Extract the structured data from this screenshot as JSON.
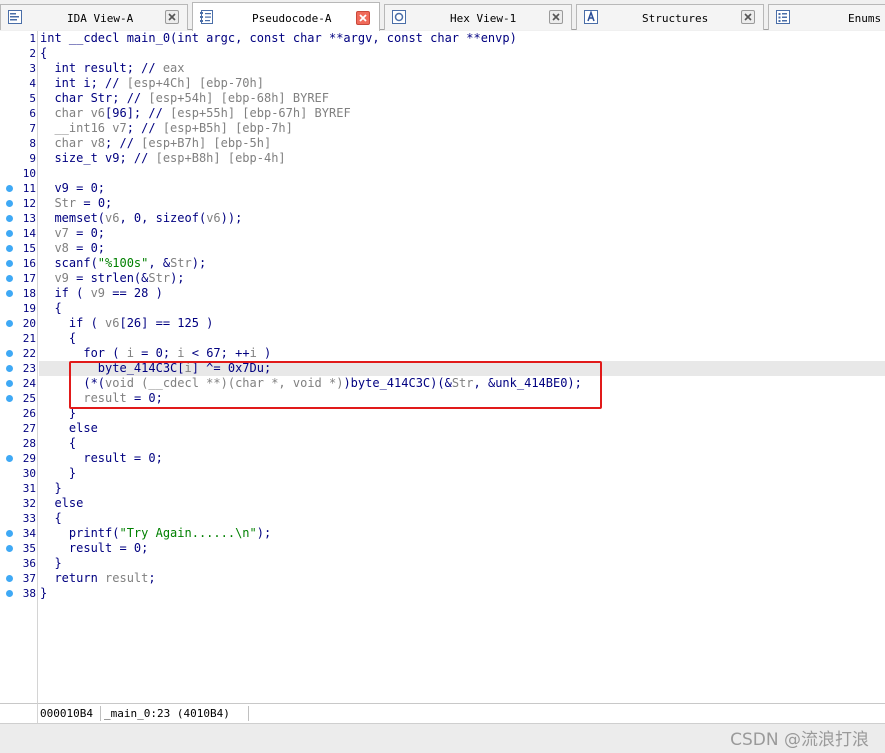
{
  "tabs": [
    {
      "label": "IDA View-A",
      "icon": "ida-view-icon"
    },
    {
      "label": "Pseudocode-A",
      "icon": "pseudocode-icon",
      "active": true
    },
    {
      "label": "Hex View-1",
      "icon": "hex-view-icon"
    },
    {
      "label": "Structures",
      "icon": "structures-icon"
    },
    {
      "label": "Enums",
      "icon": "enums-icon"
    }
  ],
  "code": {
    "line_numbers": [
      "1",
      "2",
      "3",
      "4",
      "5",
      "6",
      "7",
      "8",
      "9",
      "10",
      "11",
      "12",
      "13",
      "14",
      "15",
      "16",
      "17",
      "18",
      "19",
      "20",
      "21",
      "22",
      "23",
      "24",
      "25",
      "26",
      "27",
      "28",
      "29",
      "30",
      "31",
      "32",
      "33",
      "34",
      "35",
      "36",
      "37",
      "38"
    ],
    "breakpoint_lines": [
      11,
      12,
      13,
      14,
      15,
      16,
      17,
      18,
      20,
      22,
      23,
      24,
      25,
      29,
      34,
      35,
      37,
      38
    ],
    "highlighted_line": 23,
    "lines": [
      [
        [
          "int __cdecl main_0(int argc, const char **argv, const char **envp)",
          "n"
        ]
      ],
      [
        [
          "{",
          "n"
        ]
      ],
      [
        [
          "  int result; // ",
          "n"
        ],
        [
          "eax",
          "g"
        ]
      ],
      [
        [
          "  int i; // ",
          "n"
        ],
        [
          "[esp+4Ch] [ebp-70h]",
          "g"
        ]
      ],
      [
        [
          "  char Str; // ",
          "n"
        ],
        [
          "[esp+54h] [ebp-68h] BYREF",
          "g"
        ]
      ],
      [
        [
          "  ",
          "n"
        ],
        [
          "char v6",
          "g"
        ],
        [
          "[96]; // ",
          "n"
        ],
        [
          "[esp+55h] [ebp-67h] BYREF",
          "g"
        ]
      ],
      [
        [
          "  ",
          "n"
        ],
        [
          "__int16 v7",
          "g"
        ],
        [
          "; // ",
          "n"
        ],
        [
          "[esp+B5h] [ebp-7h]",
          "g"
        ]
      ],
      [
        [
          "  ",
          "n"
        ],
        [
          "char v8",
          "g"
        ],
        [
          "; // ",
          "n"
        ],
        [
          "[esp+B7h] [ebp-5h]",
          "g"
        ]
      ],
      [
        [
          "  size_t v9; // ",
          "n"
        ],
        [
          "[esp+B8h] [ebp-4h]",
          "g"
        ]
      ],
      [
        [
          "",
          "n"
        ]
      ],
      [
        [
          "  v9 = 0;",
          "n"
        ]
      ],
      [
        [
          "  ",
          "n"
        ],
        [
          "Str",
          "g"
        ],
        [
          " = 0;",
          "n"
        ]
      ],
      [
        [
          "  memset(",
          "n"
        ],
        [
          "v6",
          "g"
        ],
        [
          ", 0, sizeof(",
          "n"
        ],
        [
          "v6",
          "g"
        ],
        [
          "));",
          "n"
        ]
      ],
      [
        [
          "  ",
          "n"
        ],
        [
          "v7",
          "g"
        ],
        [
          " = 0;",
          "n"
        ]
      ],
      [
        [
          "  ",
          "n"
        ],
        [
          "v8",
          "g"
        ],
        [
          " = 0;",
          "n"
        ]
      ],
      [
        [
          "  scanf(",
          "n"
        ],
        [
          "\"%100s\"",
          "s"
        ],
        [
          ", &",
          "n"
        ],
        [
          "Str",
          "g"
        ],
        [
          ");",
          "n"
        ]
      ],
      [
        [
          "  ",
          "n"
        ],
        [
          "v9",
          "g"
        ],
        [
          " = strlen(&",
          "n"
        ],
        [
          "Str",
          "g"
        ],
        [
          ");",
          "n"
        ]
      ],
      [
        [
          "  if ( ",
          "n"
        ],
        [
          "v9",
          "g"
        ],
        [
          " == 28 )",
          "n"
        ]
      ],
      [
        [
          "  {",
          "n"
        ]
      ],
      [
        [
          "    if ( ",
          "n"
        ],
        [
          "v6",
          "g"
        ],
        [
          "[26] == 125 )",
          "n"
        ]
      ],
      [
        [
          "    {",
          "n"
        ]
      ],
      [
        [
          "      for ( ",
          "n"
        ],
        [
          "i",
          "g"
        ],
        [
          " = 0; ",
          "n"
        ],
        [
          "i",
          "g"
        ],
        [
          " < 67; ++",
          "n"
        ],
        [
          "i",
          "g"
        ],
        [
          " )",
          "n"
        ]
      ],
      [
        [
          "        byte_414C3C[",
          "n"
        ],
        [
          "i",
          "g"
        ],
        [
          "] ^= 0x7Du;",
          "n"
        ]
      ],
      [
        [
          "      (*(",
          "n"
        ],
        [
          "void (__cdecl **)(char *, void *)",
          "g"
        ],
        [
          ")byte_414C3C)(&",
          "n"
        ],
        [
          "Str",
          "g"
        ],
        [
          ", &unk_414BE0);",
          "n"
        ]
      ],
      [
        [
          "      ",
          "n"
        ],
        [
          "result",
          "g"
        ],
        [
          " = 0;",
          "n"
        ]
      ],
      [
        [
          "    }",
          "n"
        ]
      ],
      [
        [
          "    else",
          "n"
        ]
      ],
      [
        [
          "    {",
          "n"
        ]
      ],
      [
        [
          "      result = 0;",
          "n"
        ]
      ],
      [
        [
          "    }",
          "n"
        ]
      ],
      [
        [
          "  }",
          "n"
        ]
      ],
      [
        [
          "  else",
          "n"
        ]
      ],
      [
        [
          "  {",
          "n"
        ]
      ],
      [
        [
          "    printf(",
          "n"
        ],
        [
          "\"Try Again......\\n\"",
          "s"
        ],
        [
          ");",
          "n"
        ]
      ],
      [
        [
          "    result = 0;",
          "n"
        ]
      ],
      [
        [
          "  }",
          "n"
        ]
      ],
      [
        [
          "  return ",
          "n"
        ],
        [
          "result",
          "g"
        ],
        [
          ";",
          "n"
        ]
      ],
      [
        [
          "}",
          "n"
        ]
      ]
    ]
  },
  "status": {
    "address": "000010B4",
    "location": "_main_0:23 (4010B4)"
  },
  "watermark": "CSDN @流浪打浪",
  "colors": {
    "code_text": "#000080",
    "comment_gray": "#808080",
    "string_green": "#008000",
    "breakpoint_blue": "#3fa9f5",
    "annotation_red": "#e11a1a",
    "active_tab_close": "#f06a5a"
  }
}
